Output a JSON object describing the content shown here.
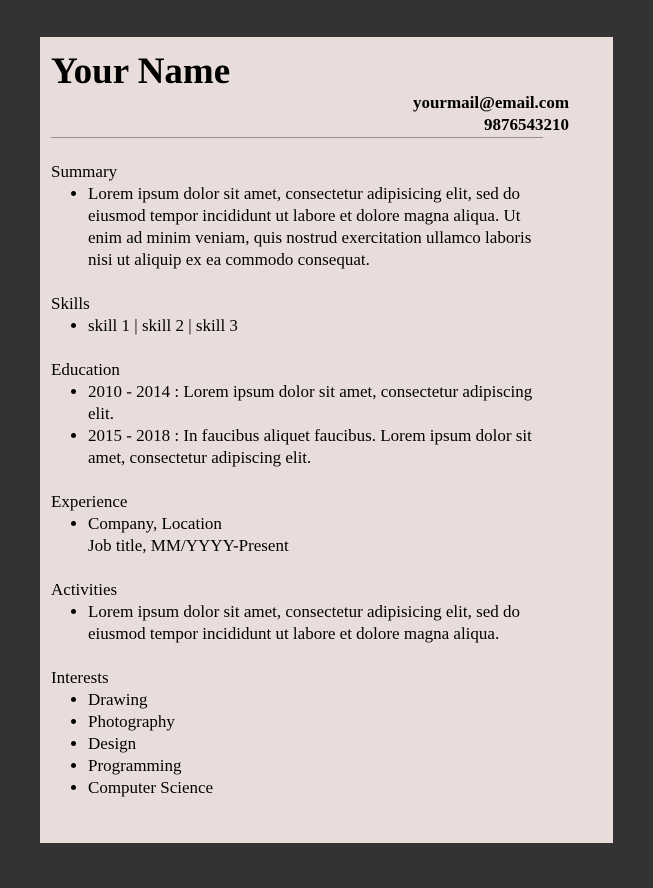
{
  "header": {
    "name": "Your Name",
    "email": "yourmail@email.com",
    "phone": "9876543210"
  },
  "summary": {
    "title": "Summary",
    "items": [
      "Lorem ipsum dolor sit amet, consectetur adipisicing elit, sed do eiusmod tempor incididunt ut labore et dolore magna aliqua. Ut enim ad minim veniam, quis nostrud exercitation ullamco laboris nisi ut aliquip ex ea commodo consequat."
    ]
  },
  "skills": {
    "title": "Skills",
    "items": [
      "skill 1 | skill 2 | skill 3"
    ]
  },
  "education": {
    "title": "Education",
    "items": [
      "2010 - 2014 : Lorem ipsum dolor sit amet, consectetur adipiscing elit.",
      "2015 - 2018 : In faucibus aliquet faucibus. Lorem ipsum dolor sit amet, consectetur adipiscing elit."
    ]
  },
  "experience": {
    "title": "Experience",
    "items": [
      {
        "company": "Company, Location",
        "role": "Job title, MM/YYYY-Present"
      }
    ]
  },
  "activities": {
    "title": "Activities",
    "items": [
      "Lorem ipsum dolor sit amet, consectetur adipisicing elit, sed do eiusmod tempor incididunt ut labore et dolore magna aliqua."
    ]
  },
  "interests": {
    "title": "Interests",
    "items": [
      "Drawing",
      "Photography",
      "Design",
      "Programming",
      "Computer Science"
    ]
  }
}
